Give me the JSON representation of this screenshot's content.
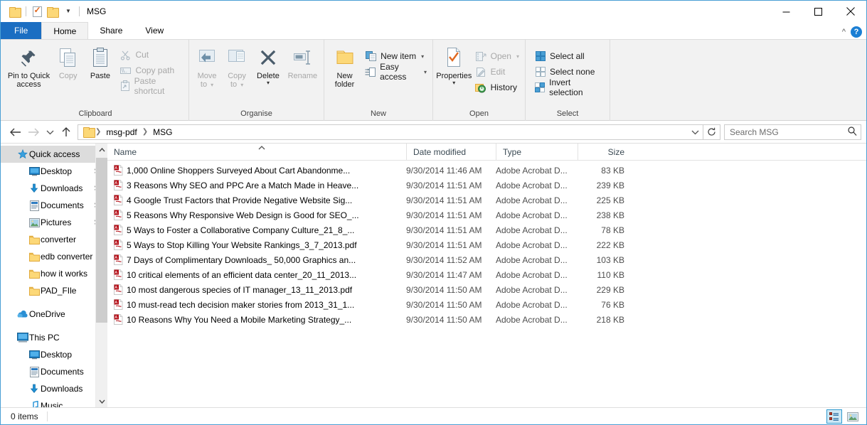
{
  "window": {
    "title": "MSG",
    "minimize_label": "minimize",
    "maximize_label": "maximize",
    "close_label": "close"
  },
  "quick_access_toolbar": {
    "items": [
      {
        "name": "folder-icon",
        "label": "Folder"
      },
      {
        "name": "properties-icon",
        "label": "Properties"
      },
      {
        "name": "new-folder-icon",
        "label": "New folder"
      },
      {
        "name": "customize-caret",
        "label": "Customise Quick Access Toolbar"
      }
    ]
  },
  "tabs": [
    {
      "id": "file",
      "label": "File"
    },
    {
      "id": "home",
      "label": "Home"
    },
    {
      "id": "share",
      "label": "Share"
    },
    {
      "id": "view",
      "label": "View"
    }
  ],
  "tab_right": {
    "collapse_label": "^",
    "help_label": "?"
  },
  "ribbon": {
    "groups": [
      {
        "id": "clipboard",
        "label": "Clipboard",
        "big": [
          {
            "label": "Pin to Quick\naccess",
            "line1": "Pin to Quick",
            "line2": "access",
            "icon": "pin-icon",
            "disabled": false
          },
          {
            "label": "Copy",
            "line1": "Copy",
            "line2": "",
            "icon": "copy-icon",
            "disabled": true
          },
          {
            "label": "Paste",
            "line1": "Paste",
            "line2": "",
            "icon": "paste-icon",
            "disabled": false
          }
        ],
        "small": [
          {
            "label": "Cut",
            "icon": "scissors-icon",
            "disabled": true
          },
          {
            "label": "Copy path",
            "icon": "copy-path-icon",
            "disabled": true
          },
          {
            "label": "Paste shortcut",
            "icon": "paste-shortcut-icon",
            "disabled": true
          }
        ]
      },
      {
        "id": "organise",
        "label": "Organise",
        "big": [
          {
            "line1": "Move",
            "line2": "to",
            "icon": "move-to-icon",
            "disabled": true,
            "caret": true
          },
          {
            "line1": "Copy",
            "line2": "to",
            "icon": "copy-to-icon",
            "disabled": true,
            "caret": true
          },
          {
            "line1": "Delete",
            "line2": "",
            "icon": "delete-icon",
            "disabled": false,
            "caret": true
          },
          {
            "line1": "Rename",
            "line2": "",
            "icon": "rename-icon",
            "disabled": true,
            "caret": false
          }
        ],
        "small": []
      },
      {
        "id": "new",
        "label": "New",
        "big": [
          {
            "line1": "New",
            "line2": "folder",
            "icon": "new-folder-icon",
            "disabled": false
          }
        ],
        "small": [
          {
            "label": "New item",
            "icon": "new-item-icon",
            "disabled": false,
            "caret": true
          },
          {
            "label": "Easy access",
            "icon": "easy-access-icon",
            "disabled": false,
            "caret": true
          }
        ]
      },
      {
        "id": "open",
        "label": "Open",
        "big": [
          {
            "line1": "Properties",
            "line2": "",
            "icon": "properties-icon",
            "disabled": false,
            "caret": true
          }
        ],
        "small": [
          {
            "label": "Open",
            "icon": "open-icon",
            "disabled": true,
            "caret": true
          },
          {
            "label": "Edit",
            "icon": "edit-icon",
            "disabled": true
          },
          {
            "label": "History",
            "icon": "history-icon",
            "disabled": false
          }
        ]
      },
      {
        "id": "select",
        "label": "Select",
        "big": [],
        "small": [
          {
            "label": "Select all",
            "icon": "select-all-icon",
            "disabled": false
          },
          {
            "label": "Select none",
            "icon": "select-none-icon",
            "disabled": false
          },
          {
            "label": "Invert selection",
            "icon": "invert-selection-icon",
            "disabled": false
          }
        ]
      }
    ]
  },
  "addressbar": {
    "back_label": "←",
    "forward_label": "→",
    "recent_label": "⌄",
    "up_label": "↑",
    "breadcrumbs": [
      "msg-pdf",
      "MSG"
    ],
    "dropdown_label": "⌄",
    "refresh_label": "↻"
  },
  "search": {
    "placeholder": "Search MSG",
    "value": "",
    "icon": "search-icon"
  },
  "sidebar": {
    "items": [
      {
        "label": "Quick access",
        "icon": "star-icon",
        "indent": 0,
        "selected": true,
        "pinned": false,
        "gap_before": false
      },
      {
        "label": "Desktop",
        "icon": "desktop-icon",
        "indent": 1,
        "selected": false,
        "pinned": true,
        "gap_before": false
      },
      {
        "label": "Downloads",
        "icon": "downloads-icon",
        "indent": 1,
        "selected": false,
        "pinned": true,
        "gap_before": false
      },
      {
        "label": "Documents",
        "icon": "documents-icon",
        "indent": 1,
        "selected": false,
        "pinned": true,
        "gap_before": false
      },
      {
        "label": "Pictures",
        "icon": "pictures-icon",
        "indent": 1,
        "selected": false,
        "pinned": true,
        "gap_before": false
      },
      {
        "label": "converter",
        "icon": "folder-icon",
        "indent": 1,
        "selected": false,
        "pinned": false,
        "gap_before": false
      },
      {
        "label": "edb converter",
        "icon": "folder-icon",
        "indent": 1,
        "selected": false,
        "pinned": false,
        "gap_before": false
      },
      {
        "label": "how it works",
        "icon": "folder-icon",
        "indent": 1,
        "selected": false,
        "pinned": false,
        "gap_before": false
      },
      {
        "label": "PAD_FIle",
        "icon": "folder-icon",
        "indent": 1,
        "selected": false,
        "pinned": false,
        "gap_before": false
      },
      {
        "label": "OneDrive",
        "icon": "onedrive-icon",
        "indent": 0,
        "selected": false,
        "pinned": false,
        "gap_before": true
      },
      {
        "label": "This PC",
        "icon": "thispc-icon",
        "indent": 0,
        "selected": false,
        "pinned": false,
        "gap_before": true
      },
      {
        "label": "Desktop",
        "icon": "desktop-icon",
        "indent": 1,
        "selected": false,
        "pinned": false,
        "gap_before": false
      },
      {
        "label": "Documents",
        "icon": "documents-icon",
        "indent": 1,
        "selected": false,
        "pinned": false,
        "gap_before": false
      },
      {
        "label": "Downloads",
        "icon": "downloads-icon",
        "indent": 1,
        "selected": false,
        "pinned": false,
        "gap_before": false
      },
      {
        "label": "Music",
        "icon": "music-icon",
        "indent": 1,
        "selected": false,
        "pinned": false,
        "gap_before": false
      }
    ],
    "scroll_up_label": "⌃",
    "scroll_down_label": "⌄"
  },
  "filelist": {
    "columns": [
      {
        "id": "name",
        "label": "Name",
        "sorted": true,
        "sort_dir": "asc"
      },
      {
        "id": "date",
        "label": "Date modified",
        "sorted": false
      },
      {
        "id": "type",
        "label": "Type",
        "sorted": false
      },
      {
        "id": "size",
        "label": "Size",
        "sorted": false
      }
    ],
    "rows": [
      {
        "name": "1,000 Online Shoppers Surveyed About Cart Abandonme...",
        "date": "9/30/2014 11:46 AM",
        "type": "Adobe Acrobat D...",
        "size": "83 KB",
        "icon": "pdf-icon"
      },
      {
        "name": "3 Reasons Why SEO and PPC Are a Match Made in Heave...",
        "date": "9/30/2014 11:51 AM",
        "type": "Adobe Acrobat D...",
        "size": "239 KB",
        "icon": "pdf-icon"
      },
      {
        "name": "4 Google Trust Factors that Provide Negative Website Sig...",
        "date": "9/30/2014 11:51 AM",
        "type": "Adobe Acrobat D...",
        "size": "225 KB",
        "icon": "pdf-icon"
      },
      {
        "name": "5 Reasons Why Responsive Web Design is Good for SEO_...",
        "date": "9/30/2014 11:51 AM",
        "type": "Adobe Acrobat D...",
        "size": "238 KB",
        "icon": "pdf-icon"
      },
      {
        "name": "5 Ways to Foster a Collaborative Company Culture_21_8_...",
        "date": "9/30/2014 11:51 AM",
        "type": "Adobe Acrobat D...",
        "size": "78 KB",
        "icon": "pdf-icon"
      },
      {
        "name": "5 Ways to Stop Killing Your Website Rankings_3_7_2013.pdf",
        "date": "9/30/2014 11:51 AM",
        "type": "Adobe Acrobat D...",
        "size": "222 KB",
        "icon": "pdf-icon"
      },
      {
        "name": "7 Days of Complimentary Downloads_ 50,000 Graphics an...",
        "date": "9/30/2014 11:52 AM",
        "type": "Adobe Acrobat D...",
        "size": "103 KB",
        "icon": "pdf-icon"
      },
      {
        "name": "10 critical elements of an efficient data center_20_11_2013...",
        "date": "9/30/2014 11:47 AM",
        "type": "Adobe Acrobat D...",
        "size": "110 KB",
        "icon": "pdf-icon"
      },
      {
        "name": "10 most dangerous species of IT manager_13_11_2013.pdf",
        "date": "9/30/2014 11:50 AM",
        "type": "Adobe Acrobat D...",
        "size": "229 KB",
        "icon": "pdf-icon"
      },
      {
        "name": "10 must-read tech decision maker stories from 2013_31_1...",
        "date": "9/30/2014 11:50 AM",
        "type": "Adobe Acrobat D...",
        "size": "76 KB",
        "icon": "pdf-icon"
      },
      {
        "name": "10 Reasons Why You Need a Mobile Marketing Strategy_...",
        "date": "9/30/2014 11:50 AM",
        "type": "Adobe Acrobat D...",
        "size": "218 KB",
        "icon": "pdf-icon"
      }
    ]
  },
  "statusbar": {
    "item_count": "0 items",
    "views": [
      {
        "id": "details",
        "label": "Details view",
        "icon": "details-view-icon",
        "active": true
      },
      {
        "id": "large-icons",
        "label": "Large icons view",
        "icon": "large-icons-view-icon",
        "active": false
      }
    ]
  },
  "colors": {
    "accent": "#1b6ec2",
    "window_border": "#4a9fd4",
    "ribbon_bg": "#f2f2f2",
    "selection": "#dcdcdc",
    "pdf_red": "#b5121b"
  }
}
